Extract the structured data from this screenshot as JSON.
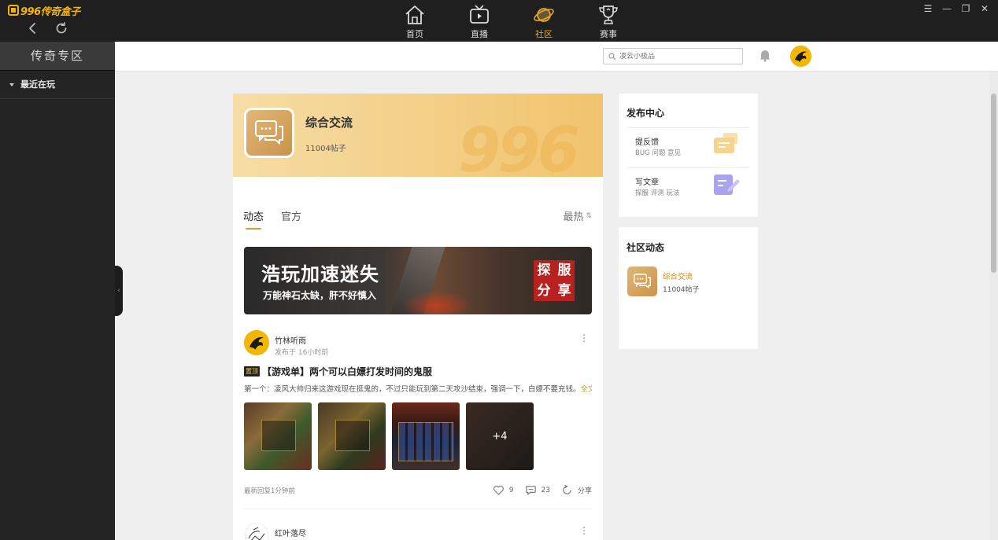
{
  "app": {
    "logo_text": "996传奇盒子",
    "nav": [
      {
        "label": "首页",
        "icon": "home-icon"
      },
      {
        "label": "直播",
        "icon": "tv-icon"
      },
      {
        "label": "社区",
        "icon": "planet-icon",
        "active": true
      },
      {
        "label": "赛事",
        "icon": "trophy-icon"
      }
    ],
    "accent_color": "#e6a82a"
  },
  "sidebar": {
    "title": "传奇专区",
    "section": "最近在玩"
  },
  "header": {
    "search_placeholder": "凌云小极品"
  },
  "forum": {
    "title": "综合交流",
    "count": "11004帖子",
    "watermark": "996"
  },
  "tabs": [
    {
      "label": "动态",
      "active": true
    },
    {
      "label": "官方",
      "active": false
    }
  ],
  "sort_label": "最热",
  "promo": {
    "title": "浩玩加速迷失",
    "subtitle": "万能神石太缺，肝不好慎入",
    "stamp": [
      "探",
      "服",
      "分",
      "享"
    ]
  },
  "posts": [
    {
      "author": "竹林听雨",
      "time": "发布于 16小时前",
      "tag": "置顶",
      "title": "【游戏单】两个可以白嫖打发时间的鬼服",
      "excerpt": "第一个：凌风大帅归来这游戏现在挺鬼的，不过只能玩到第二天攻沙结束，强调一下，白嫖不要充钱。",
      "read_more": "全文",
      "more_images": "+4",
      "last_reply": "最新回复1分钟前",
      "likes": "9",
      "comments": "23",
      "share": "分享"
    },
    {
      "author": "红叶落尽"
    }
  ],
  "publish_center": {
    "title": "发布中心",
    "items": [
      {
        "label": "提反馈",
        "sub": "BUG 问题 意见"
      },
      {
        "label": "写文章",
        "sub": "探服 评测 玩法"
      }
    ]
  },
  "community": {
    "title": "社区动态",
    "items": [
      {
        "name": "综合交流",
        "count": "11004帖子"
      }
    ]
  }
}
